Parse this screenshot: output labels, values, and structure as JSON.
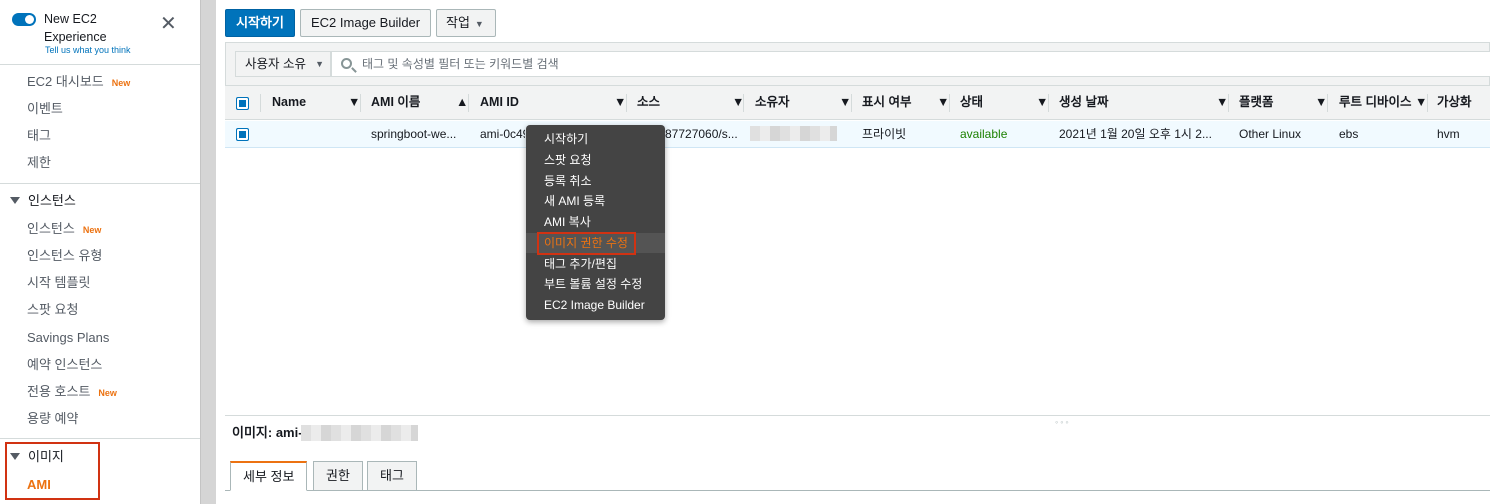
{
  "sidebar": {
    "toggle_title": "New EC2 Experience",
    "toggle_sub": "Tell us what you think",
    "items_top": [
      {
        "label": "EC2 대시보드",
        "badge": "New"
      },
      {
        "label": "이벤트",
        "badge": ""
      },
      {
        "label": "태그",
        "badge": ""
      },
      {
        "label": "제한",
        "badge": ""
      }
    ],
    "section_instances": "인스턴스",
    "items_instances": [
      {
        "label": "인스턴스",
        "badge": "New"
      },
      {
        "label": "인스턴스 유형",
        "badge": ""
      },
      {
        "label": "시작 템플릿",
        "badge": ""
      },
      {
        "label": "스팟 요청",
        "badge": ""
      },
      {
        "label": "Savings Plans",
        "badge": ""
      },
      {
        "label": "예약 인스턴스",
        "badge": ""
      },
      {
        "label": "전용 호스트",
        "badge": "New"
      },
      {
        "label": "용량 예약",
        "badge": ""
      }
    ],
    "section_images": "이미지",
    "item_ami": "AMI"
  },
  "toolbar": {
    "launch": "시작하기",
    "image_builder": "EC2 Image Builder",
    "actions": "작업"
  },
  "filter": {
    "owner_select": "사용자 소유",
    "placeholder": "태그 및 속성별 필터 또는 키워드별 검색"
  },
  "table": {
    "headers": [
      "Name",
      "AMI 이름",
      "AMI ID",
      "소스",
      "소유자",
      "표시 여부",
      "상태",
      "생성 날짜",
      "플랫폼",
      "루트 디바이스",
      "가상화"
    ],
    "row": {
      "name": "",
      "ami_name": "springboot-we...",
      "ami_id": "ami-0c49",
      "source": "87727060/s...",
      "visibility": "프라이빗",
      "status": "available",
      "created": "2021년 1월 20일 오후 1시 2...",
      "platform": "Other Linux",
      "root_device": "ebs",
      "virtualization": "hvm"
    }
  },
  "context_menu": {
    "items": [
      "시작하기",
      "스팟 요청",
      "등록 취소",
      "새 AMI 등록",
      "AMI 복사",
      "이미지 권한 수정",
      "태그 추가/편집",
      "부트 볼륨 설정 수정",
      "EC2 Image Builder"
    ],
    "highlighted_index": 5
  },
  "detail": {
    "title": "이미지: ami-",
    "tabs": [
      "세부 정보",
      "권한",
      "태그"
    ],
    "active_tab": 0
  },
  "colors": {
    "primary": "#0073bb",
    "accent": "#ec7211",
    "status_available": "#1d8102",
    "highlight_box": "#d13212"
  }
}
